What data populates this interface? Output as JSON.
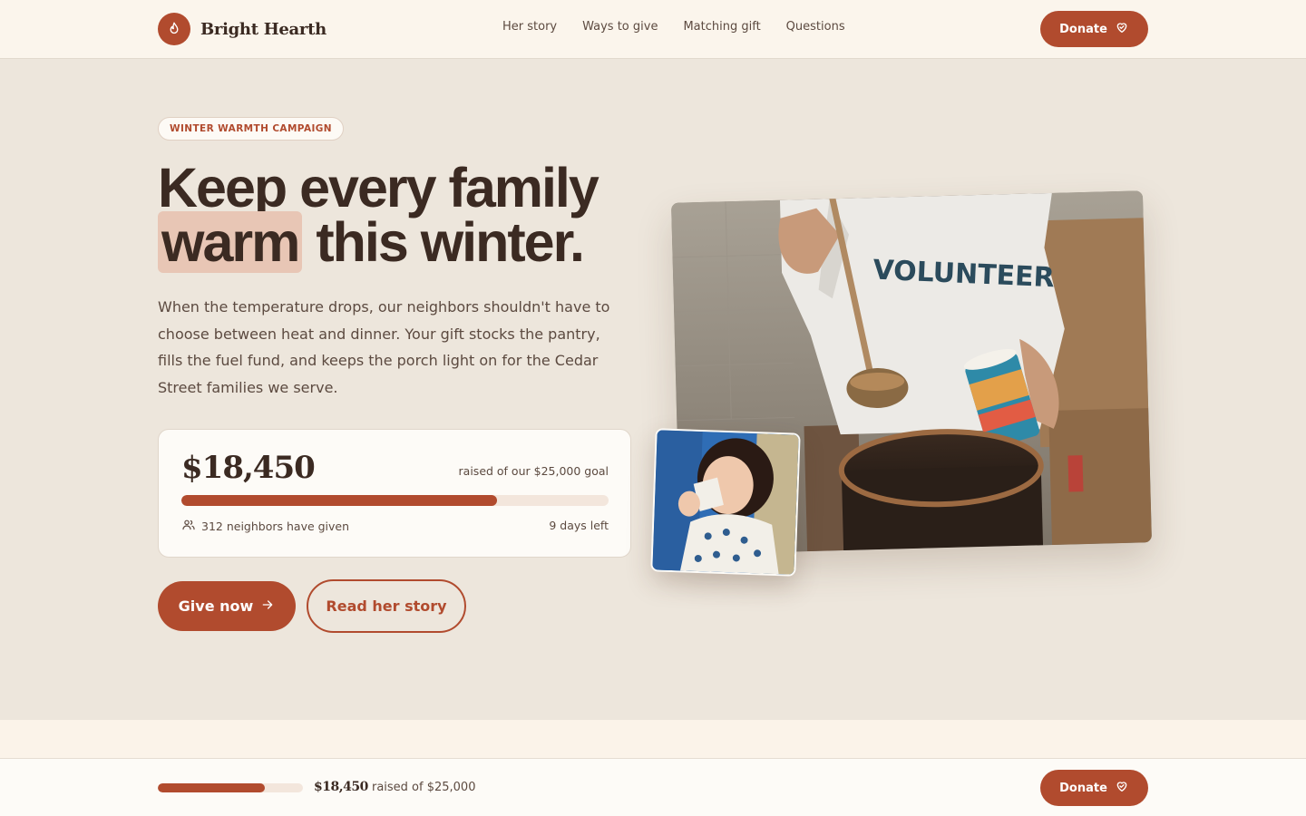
{
  "brand": {
    "name": "Bright Hearth",
    "logo_icon": "flame-icon"
  },
  "nav": {
    "items": [
      "Her story",
      "Ways to give",
      "Matching gift",
      "Questions"
    ]
  },
  "header": {
    "donate_label": "Donate",
    "donate_icon": "heart-icon"
  },
  "hero": {
    "badge": "WINTER WARMTH CAMPAIGN",
    "headline_line1": "Keep every family",
    "headline_highlight": "warm",
    "headline_rest": "this winter.",
    "lede": "When the temperature drops, our neighbors shouldn't have to choose between heat and dinner. Your gift stocks the pantry, fills the fuel fund, and keeps the porch light on for the Cedar Street families we serve."
  },
  "progress": {
    "amount": "$18,450",
    "goal_text": "raised of our $25,000 goal",
    "raised": 18450,
    "goal": 25000,
    "fraction": 0.738,
    "donors_text": "312 neighbors have given",
    "donors_icon": "people-icon",
    "days_left": "9 days left"
  },
  "cta": {
    "primary": "Give now",
    "primary_icon": "arrow-right-icon",
    "secondary": "Read her story"
  },
  "photos": {
    "main_shirt_text": "VOLUNTEER"
  },
  "sticky": {
    "amount": "$18,450",
    "suffix": "raised of $25,000",
    "donate_label": "Donate"
  },
  "colors": {
    "accent": "#b14b2e",
    "background": "#ede6dc",
    "header_bg": "#fbf5ec",
    "text": "#3b2a22",
    "highlight": "#e8c6b5"
  }
}
